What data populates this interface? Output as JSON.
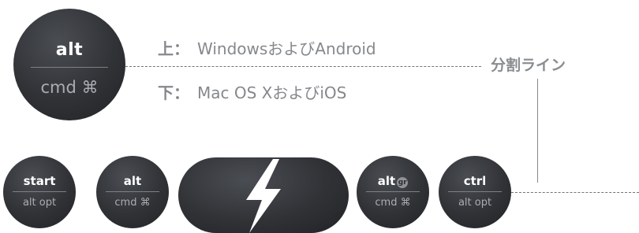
{
  "big_key": {
    "top": "alt",
    "bottom": "cmd ⌘"
  },
  "labels": {
    "upper_mark": "上：",
    "upper_text": "WindowsおよびAndroid",
    "lower_mark": "下：",
    "lower_text": "Mac OS XおよびiOS",
    "split": "分割ライン"
  },
  "keys": [
    {
      "top": "start",
      "bottom": "alt opt"
    },
    {
      "top": "alt",
      "bottom": "cmd ⌘"
    },
    {
      "top": "alt",
      "badge": "gr",
      "bottom": "cmd ⌘"
    },
    {
      "top": "ctrl",
      "bottom": "alt opt"
    }
  ],
  "icons": {
    "pill": "lightning-bolt-icon"
  },
  "colors": {
    "key": "#303236",
    "text_gray": "#85888c",
    "white": "#ffffff"
  }
}
